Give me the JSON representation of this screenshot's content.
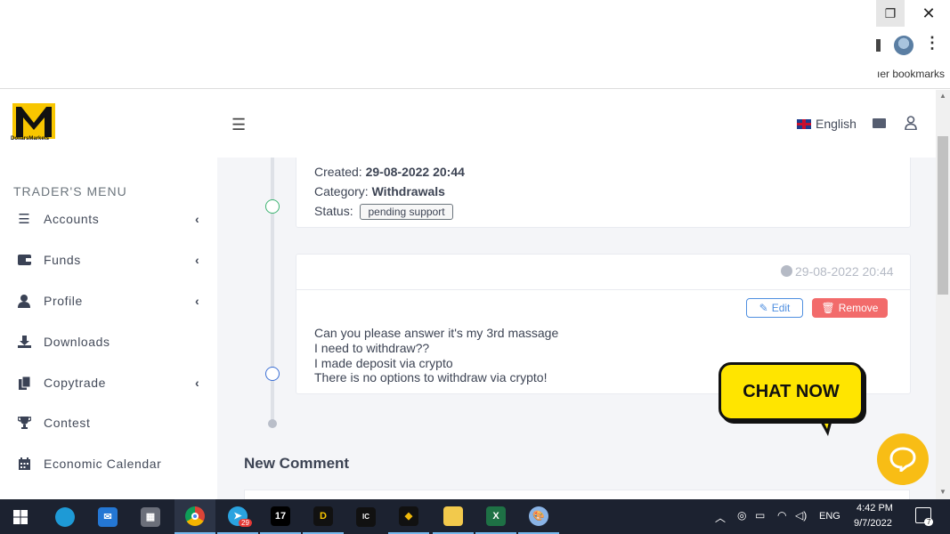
{
  "browser": {
    "restore_icon": "restore-icon",
    "close_icon": "close-icon",
    "bookmarks_label": "ıer bookmarks"
  },
  "sidebar": {
    "logo_text": "DollarsMarkets",
    "menu_title": "TRADER'S MENU",
    "items": [
      {
        "label": "Accounts",
        "icon": "list-icon",
        "has_submenu": true
      },
      {
        "label": "Funds",
        "icon": "wallet-icon",
        "has_submenu": true
      },
      {
        "label": "Profile",
        "icon": "user-icon",
        "has_submenu": true
      },
      {
        "label": "Downloads",
        "icon": "download-icon",
        "has_submenu": false
      },
      {
        "label": "Copytrade",
        "icon": "copy-icon",
        "has_submenu": true
      },
      {
        "label": "Contest",
        "icon": "trophy-icon",
        "has_submenu": false
      },
      {
        "label": "Economic Calendar",
        "icon": "calendar-icon",
        "has_submenu": false
      }
    ]
  },
  "header": {
    "language": "English"
  },
  "ticket": {
    "created_label": "Created:",
    "created_value": "29-08-2022 20:44",
    "category_label": "Category:",
    "category_value": "Withdrawals",
    "status_label": "Status:",
    "status_value": "pending support"
  },
  "comment": {
    "date": "29-08-2022 20:44",
    "edit_label": "Edit",
    "remove_label": "Remove",
    "lines": [
      "Can you please answer it's my 3rd massage",
      "I need to withdraw??",
      "I made deposit via crypto",
      "There is no options to withdraw via crypto!"
    ]
  },
  "new_comment": {
    "heading": "New Comment"
  },
  "chat": {
    "bubble_label": "CHAT NOW"
  },
  "taskbar": {
    "telegram_badge": "29",
    "apps": [
      "start",
      "edge",
      "mail",
      "calculator",
      "chrome",
      "telegram",
      "tradingview",
      "dollarsmarkets",
      "icmarkets",
      "binance",
      "file-explorer",
      "excel",
      "paint"
    ],
    "language": "ENG",
    "time": "4:42 PM",
    "date": "9/7/2022",
    "notification_count": "7"
  },
  "colors": {
    "accent_blue": "#4f8fe0",
    "remove_red": "#f26b6b",
    "chat_yellow": "#ffe500",
    "fab_yellow": "#f8bd15",
    "taskbar_bg": "#1c2230"
  }
}
